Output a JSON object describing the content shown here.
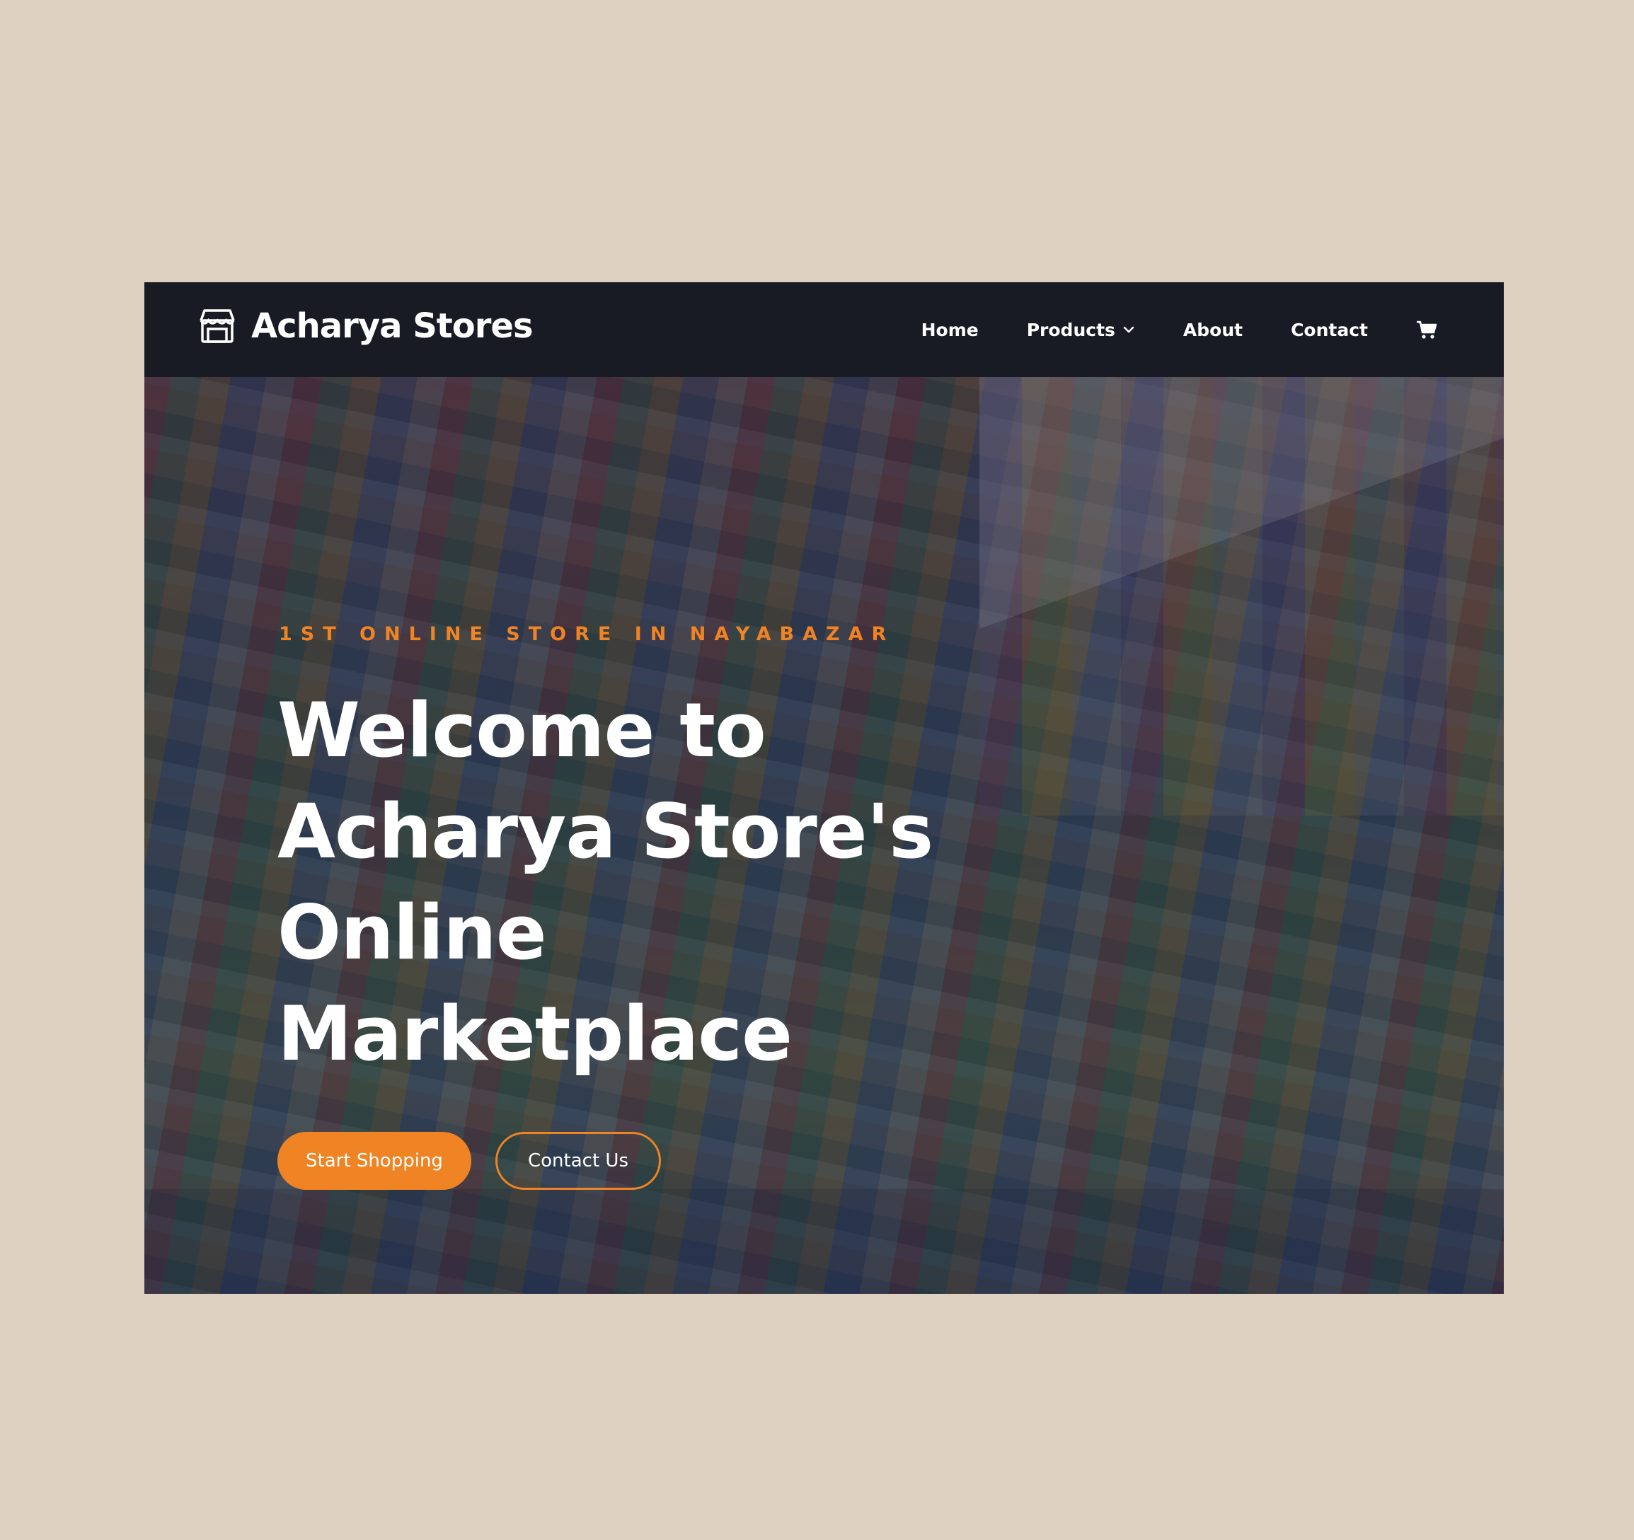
{
  "brand": {
    "name": "Acharya Stores",
    "icon": "storefront-icon"
  },
  "nav": {
    "items": [
      {
        "label": "Home"
      },
      {
        "label": "Products",
        "has_dropdown": true
      },
      {
        "label": "About"
      },
      {
        "label": "Contact"
      }
    ],
    "cart_icon": "cart-icon"
  },
  "hero": {
    "eyebrow": "1ST ONLINE STORE IN NAYABAZAR",
    "headline_lines": [
      "Welcome to",
      "Acharya Store's",
      "Online",
      "Marketplace"
    ],
    "primary_button": "Start Shopping",
    "secondary_button": "Contact Us",
    "background": "grocery-shelves-photo"
  },
  "colors": {
    "page_bg": "#ded1c1",
    "navbar_bg": "#191b24",
    "accent": "#f08323",
    "text": "#ffffff"
  }
}
